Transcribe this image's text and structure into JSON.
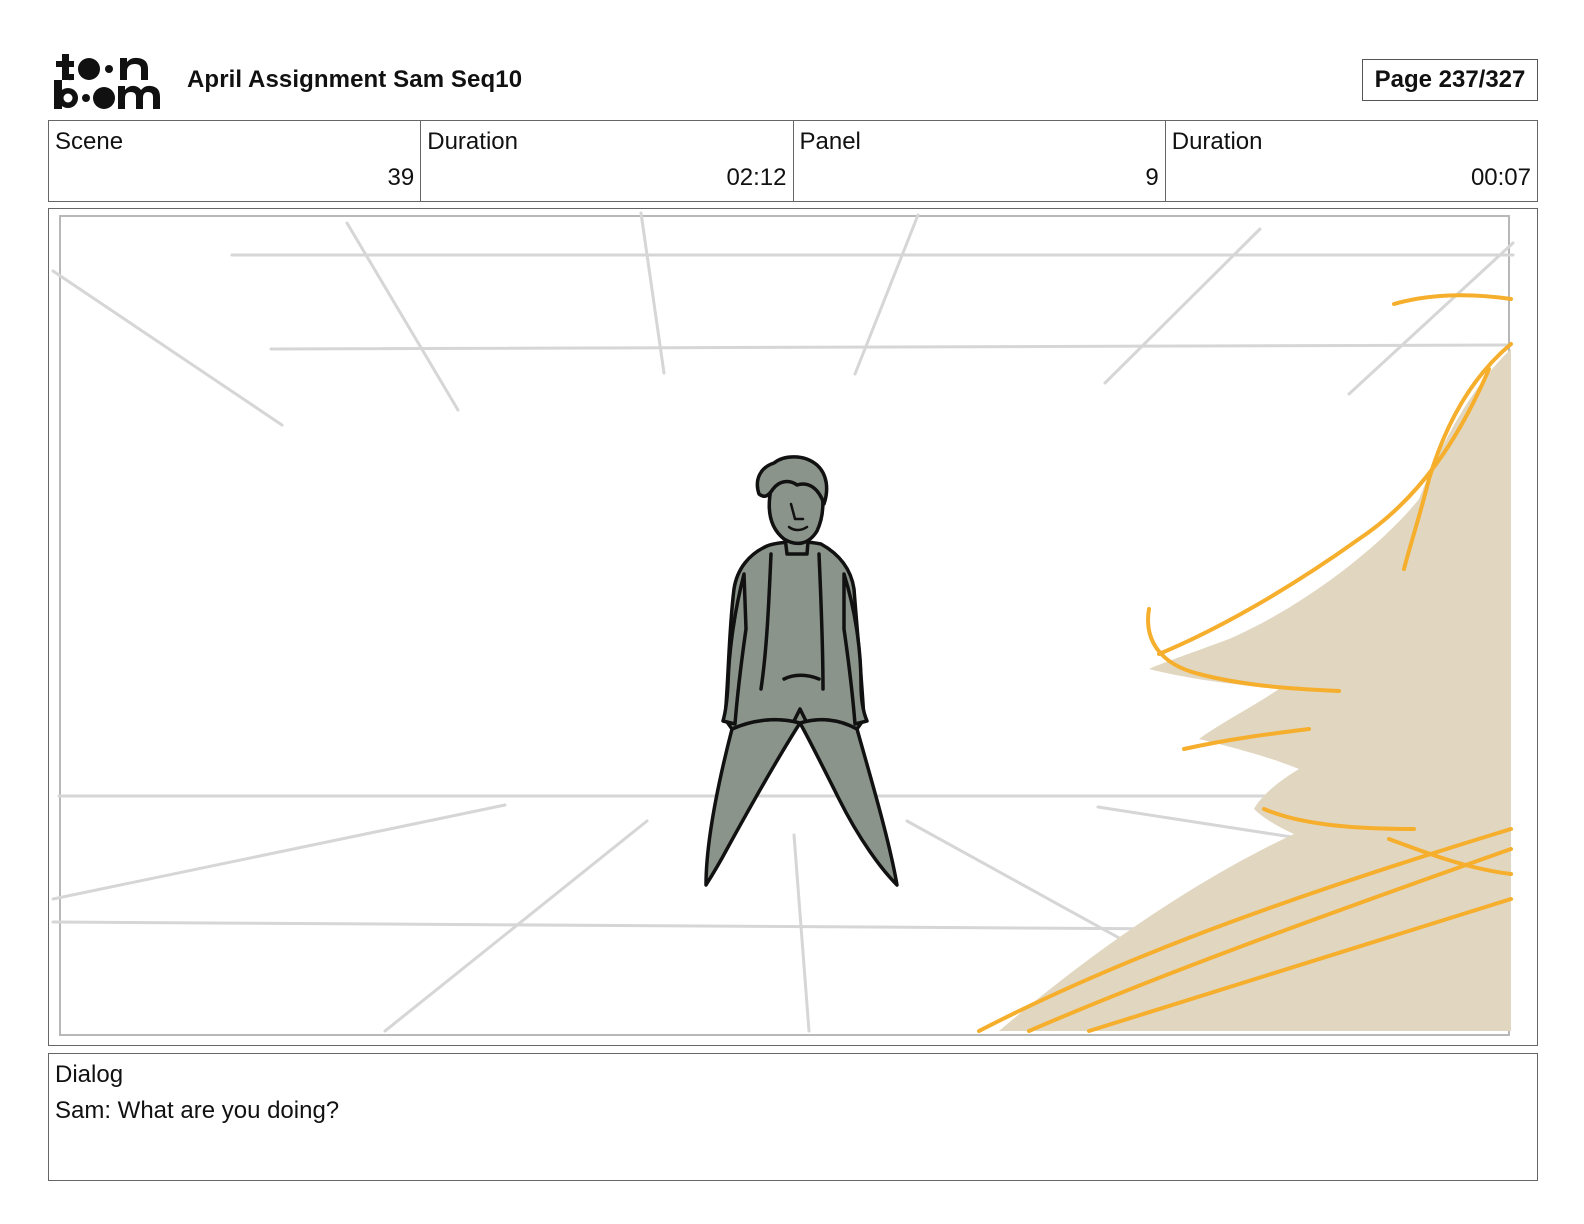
{
  "brand": {
    "logo_text_top": "to•n",
    "logo_text_bottom": "b••m"
  },
  "header": {
    "title": "April Assignment Sam Seq10",
    "page": "Page 237/327"
  },
  "info": {
    "scene_label": "Scene",
    "scene_value": "39",
    "scene_duration_label": "Duration",
    "scene_duration_value": "02:12",
    "panel_label": "Panel",
    "panel_value": "9",
    "panel_duration_label": "Duration",
    "panel_duration_value": "00:07"
  },
  "dialog": {
    "label": "Dialog",
    "text": "Sam: What are you doing?"
  },
  "colors": {
    "figure_fill": "#8b948a",
    "foreground_fill": "#e1d6c0",
    "foreground_lines": "#f6ae2d",
    "guide_lines": "#d6d6d6",
    "frame_border": "#666666"
  }
}
